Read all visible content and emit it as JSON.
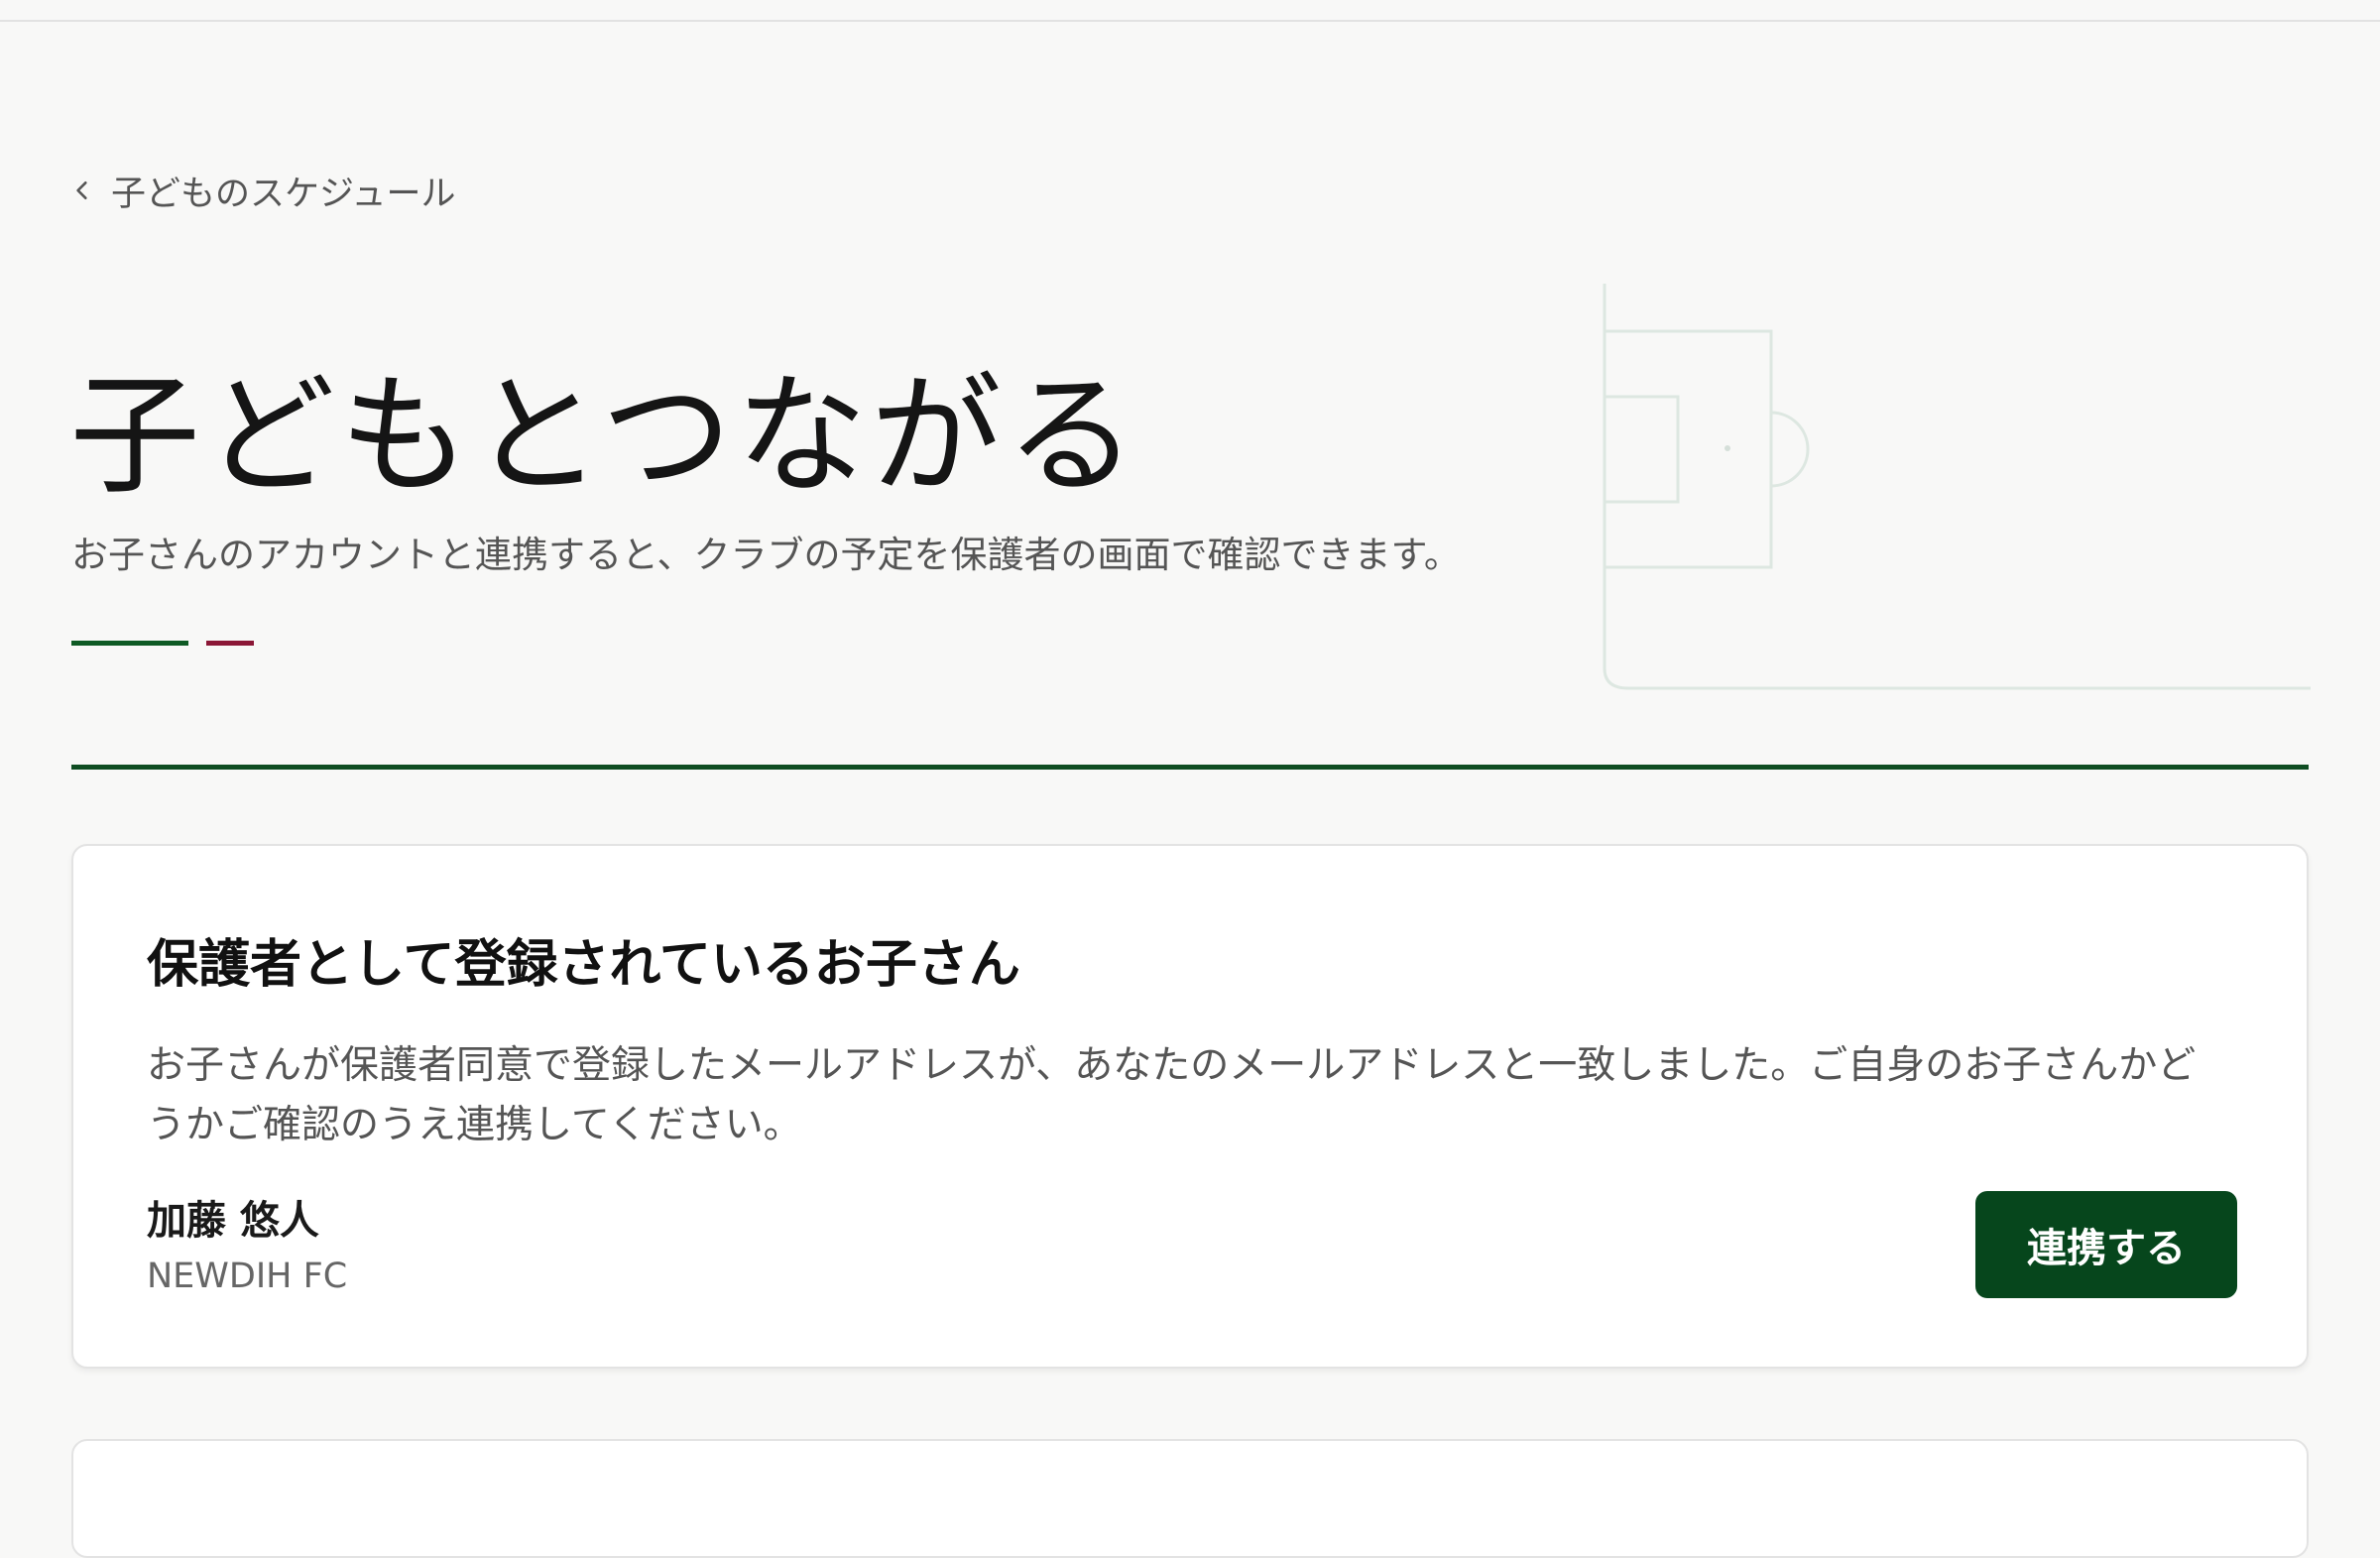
{
  "nav": {
    "back_label": "子どものスケジュール",
    "back_icon": "chevron-left-icon"
  },
  "header": {
    "title": "子どもとつながる",
    "subtitle": "お子さんのアカウントと連携すると、クラブの予定を保護者の画面で確認できます。"
  },
  "colors": {
    "brand_green": "#06461c",
    "accent_red": "#8b1736",
    "background": "#f8f8f7"
  },
  "matched_children": {
    "title": "保護者として登録されているお子さん",
    "description": "お子さんが保護者同意で登録したメールアドレスが、あなたのメールアドレスと一致しました。ご自身のお子さんかどうかご確認のうえ連携してください。",
    "children": [
      {
        "name": "加藤 悠人",
        "club": "NEWDIH FC",
        "action_label": "連携する"
      }
    ]
  }
}
